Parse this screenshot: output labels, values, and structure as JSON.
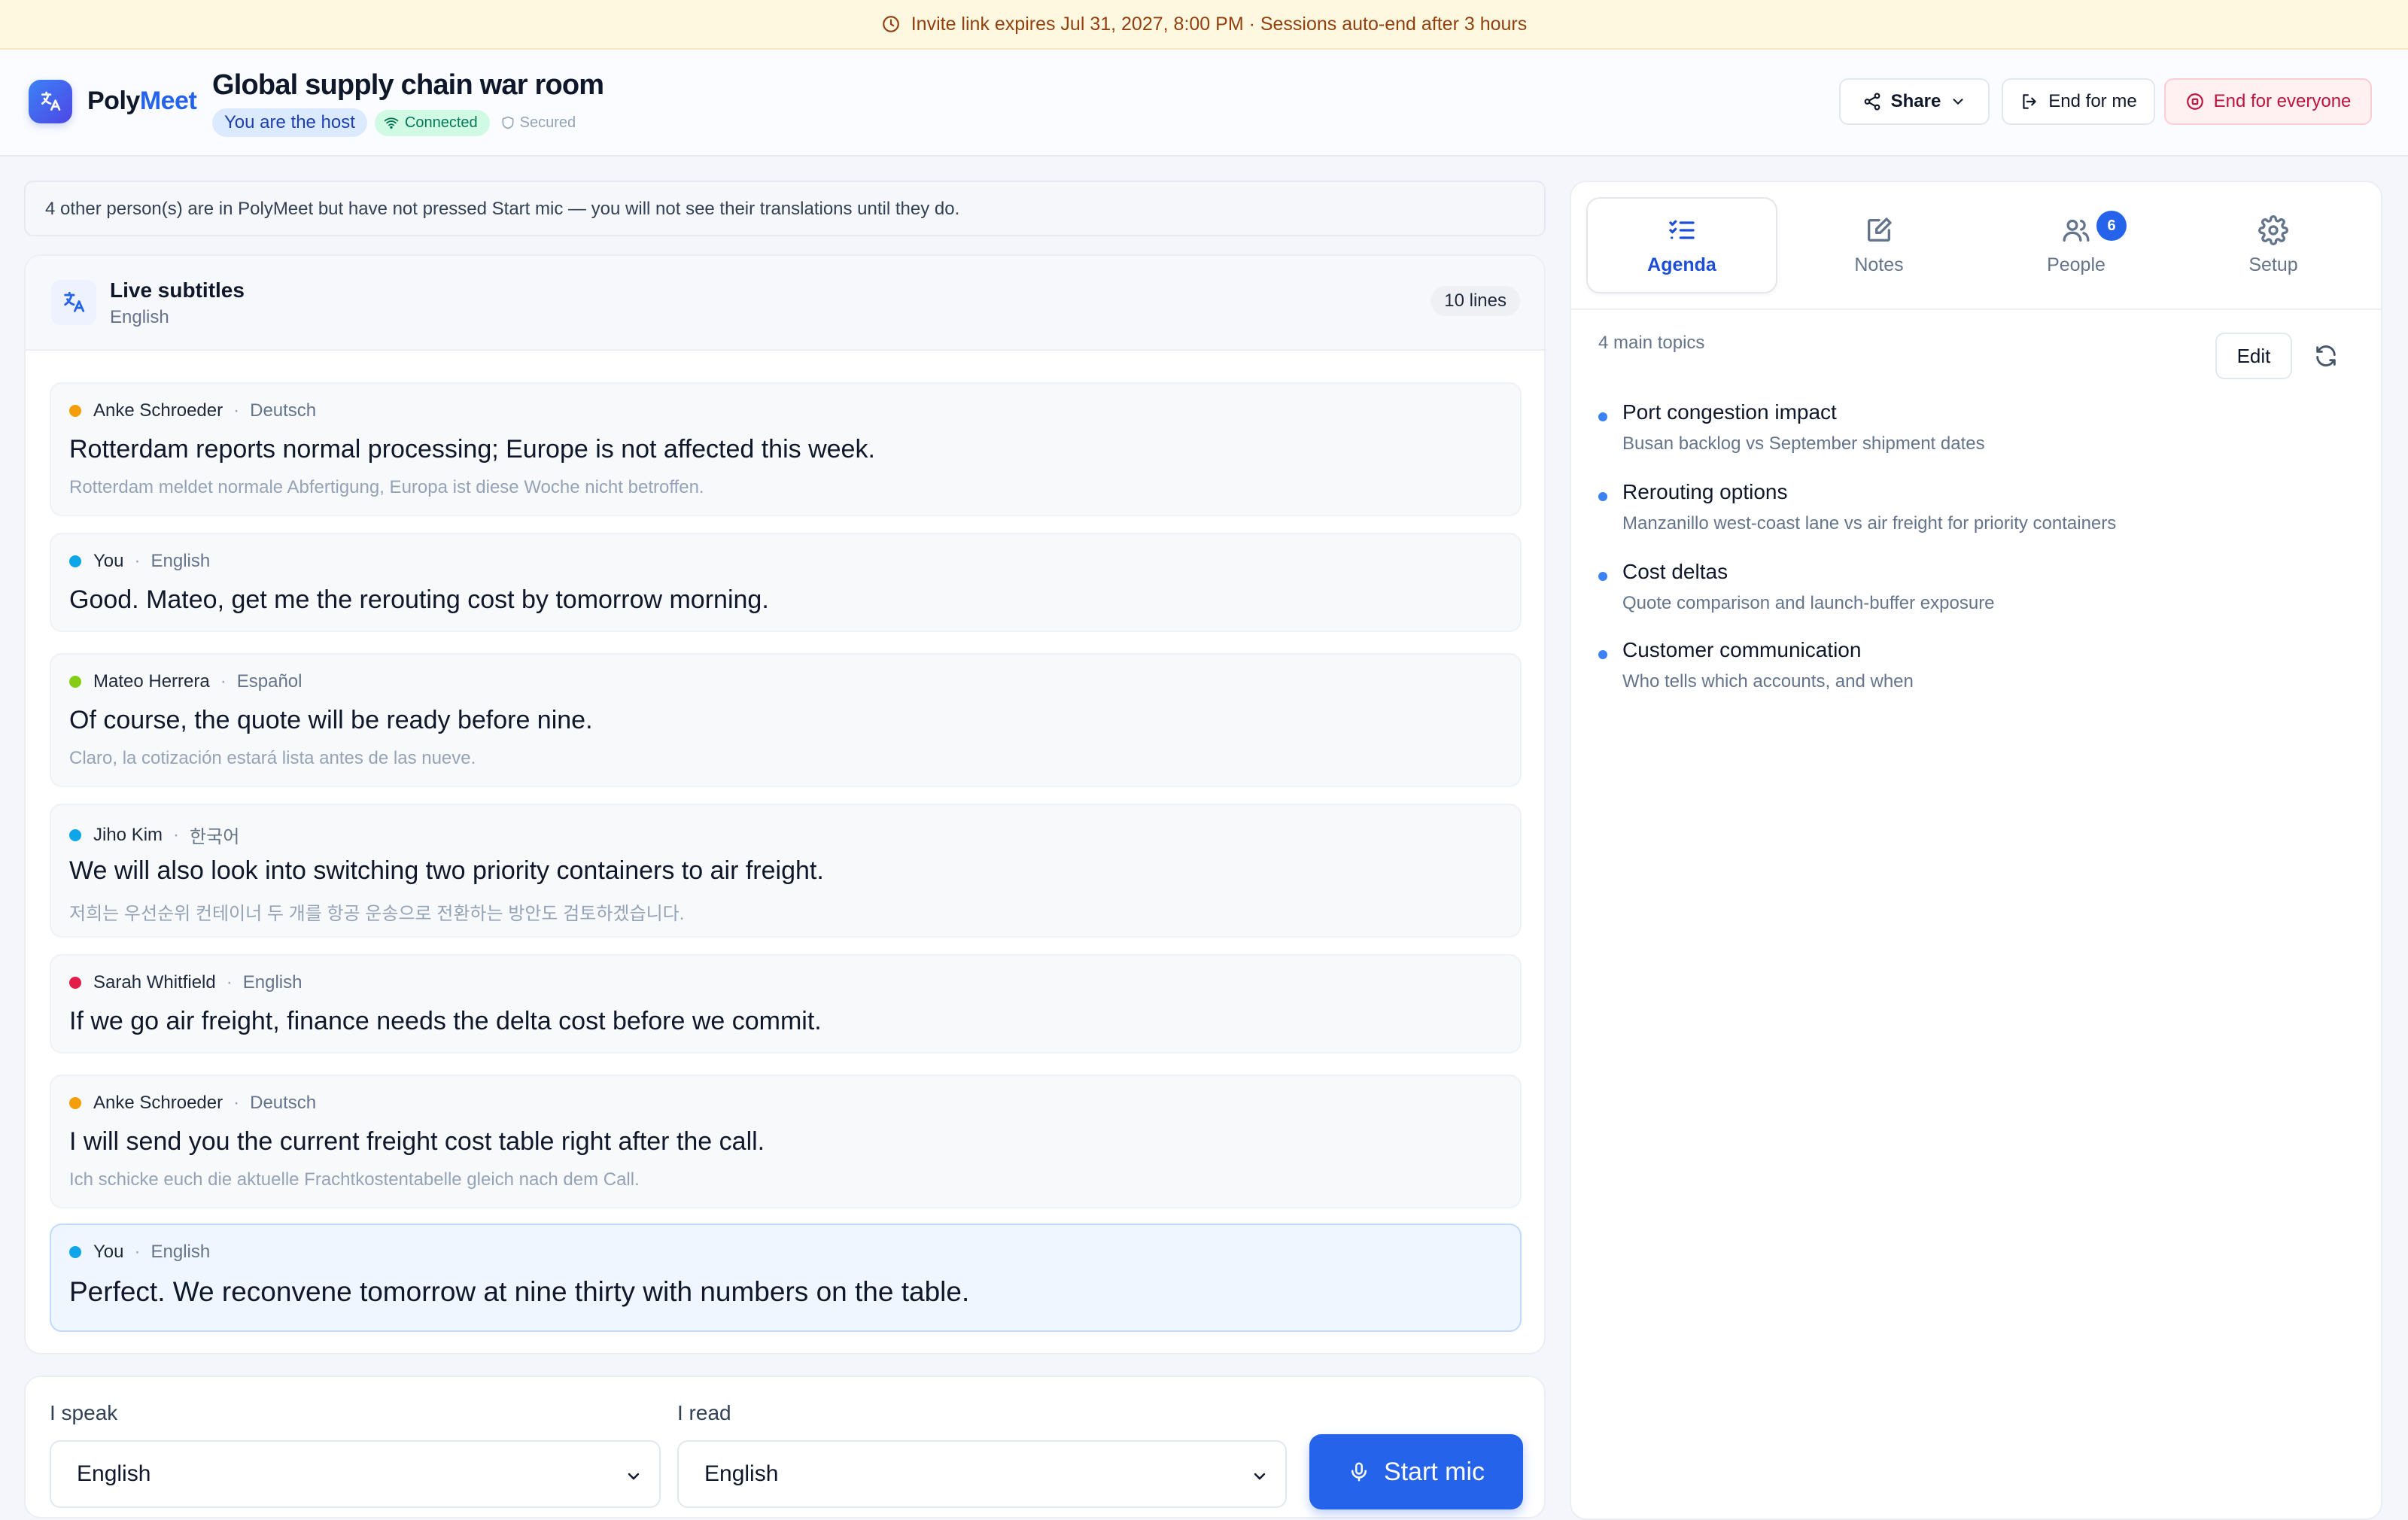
{
  "banner": {
    "text": "Invite link expires Jul 31, 2027, 8:00 PM · Sessions auto-end after 3 hours"
  },
  "header": {
    "brand_part1": "Poly",
    "brand_part2": "Meet",
    "room_title": "Global supply chain war room",
    "host_chip": "You are the host",
    "connection_chip": "Connected",
    "security_chip": "Secured",
    "share_label": "Share",
    "end_for_me_label": "End for me",
    "end_for_everyone_label": "End for everyone"
  },
  "notice": "4 other person(s) are in PolyMeet but have not pressed Start mic — you will not see their translations until they do.",
  "subtitles": {
    "title": "Live subtitles",
    "language": "English",
    "lines_badge": "10 lines",
    "messages": [
      {
        "speaker": "Anke Schroeder",
        "language": "Deutsch",
        "dot_color": "#f59e0b",
        "text": "Rotterdam reports normal processing; Europe is not affected this week.",
        "original": "Rotterdam meldet normale Abfertigung, Europa ist diese Woche nicht betroffen."
      },
      {
        "speaker": "You",
        "language": "English",
        "dot_color": "#0ea5e9",
        "text": "Good. Mateo, get me the rerouting cost by tomorrow morning.",
        "original": ""
      },
      {
        "speaker": "Mateo Herrera",
        "language": "Español",
        "dot_color": "#84cc16",
        "text": "Of course, the quote will be ready before nine.",
        "original": "Claro, la cotización estará lista antes de las nueve."
      },
      {
        "speaker": "Jiho Kim",
        "language": "한국어",
        "dot_color": "#0ea5e9",
        "text": "We will also look into switching two priority containers to air freight.",
        "original": "저희는 우선순위 컨테이너 두 개를 항공 운송으로 전환하는 방안도 검토하겠습니다."
      },
      {
        "speaker": "Sarah Whitfield",
        "language": "English",
        "dot_color": "#e11d48",
        "text": "If we go air freight, finance needs the delta cost before we commit.",
        "original": ""
      },
      {
        "speaker": "Anke Schroeder",
        "language": "Deutsch",
        "dot_color": "#f59e0b",
        "text": "I will send you the current freight cost table right after the call.",
        "original": "Ich schicke euch die aktuelle Frachtkostentabelle gleich nach dem Call."
      },
      {
        "speaker": "You",
        "language": "English",
        "dot_color": "#0ea5e9",
        "text": "Perfect. We reconvene tomorrow at nine thirty with numbers on the table.",
        "original": ""
      }
    ]
  },
  "controls": {
    "speak_label": "I speak",
    "speak_value": "English",
    "read_label": "I read",
    "read_value": "English",
    "start_mic_label": "Start mic"
  },
  "right_panel": {
    "tabs": [
      {
        "label": "Agenda",
        "icon": "list-check-icon"
      },
      {
        "label": "Notes",
        "icon": "edit-note-icon"
      },
      {
        "label": "People",
        "icon": "people-icon",
        "badge": "6"
      },
      {
        "label": "Setup",
        "icon": "gear-icon"
      }
    ],
    "topics_count": "4 main topics",
    "edit_label": "Edit",
    "topics": [
      {
        "title": "Port congestion impact",
        "subtitle": "Busan backlog vs September shipment dates"
      },
      {
        "title": "Rerouting options",
        "subtitle": "Manzanillo west-coast lane vs air freight for priority containers"
      },
      {
        "title": "Cost deltas",
        "subtitle": "Quote comparison and launch-buffer exposure"
      },
      {
        "title": "Customer communication",
        "subtitle": "Who tells which accounts, and when"
      }
    ]
  }
}
